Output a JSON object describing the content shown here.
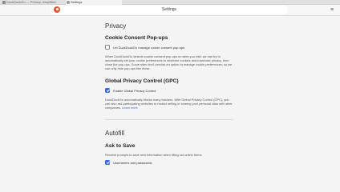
{
  "tabs": [
    {
      "label": "DuckDuckGo — Privacy, simplified.",
      "icon": "duckduckgo-tab-icon"
    },
    {
      "label": "Settings",
      "icon": "gear-icon"
    }
  ],
  "toolbar": {
    "address": "Settings",
    "menu_icon": "≡"
  },
  "privacy": {
    "title": "Privacy",
    "cookie": {
      "heading": "Cookie Consent Pop-ups",
      "checkbox_label": "Let DuckDuckGo manage cookie consent pop-ups",
      "checked": false,
      "description": "When DuckDuckGo detects cookie consent pop-ups on sites you visit, we can try to automatically set your cookie preferences to minimize cookies and maximize privacy, then close the pop-ups. Some sites don't provide an option to manage cookie preferences, so we can only hide pop-ups like these."
    },
    "gpc": {
      "heading": "Global Privacy Control (GPC)",
      "checkbox_label": "Enable Global Privacy Control",
      "checked": true,
      "description": "DuckDuckGo automatically blocks many trackers. With Global Privacy Control (GPC), you can also ask participating websites to restrict selling or sharing your personal data with other companies.",
      "learn_more": "Learn more"
    }
  },
  "autofill": {
    "title": "Autofill",
    "ask_to_save": {
      "heading": "Ask to Save",
      "description": "Receive prompts to save new information when filling out online forms.",
      "checkbox_label": "Usernames and passwords",
      "checked": true
    }
  },
  "colors": {
    "accent": "#3969ef",
    "ddg_orange": "#de5833"
  }
}
